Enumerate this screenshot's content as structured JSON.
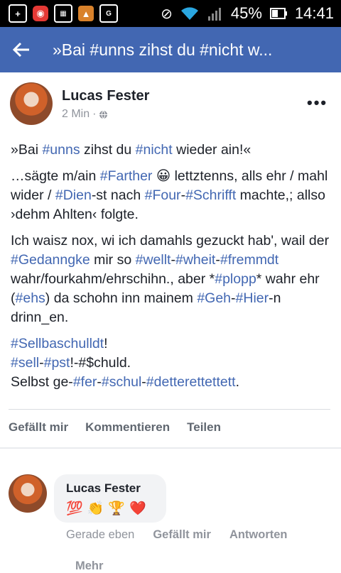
{
  "status_bar": {
    "battery": "45%",
    "time": "14:41"
  },
  "header": {
    "title": "»Bai #unns zihst du #nicht w..."
  },
  "post": {
    "author": "Lucas Fester",
    "time": "2 Min",
    "separator": "·",
    "paragraphs": [
      [
        {
          "t": "»Bai "
        },
        {
          "t": "#unns",
          "tag": true
        },
        {
          "t": " zihst du "
        },
        {
          "t": "#nicht",
          "tag": true
        },
        {
          "t": " wieder ain!«"
        }
      ],
      [
        {
          "t": "…sägte m/ain "
        },
        {
          "t": "#Farther",
          "tag": true
        },
        {
          "t": " 😀 lettztenns, alls ehr / mahl wider / "
        },
        {
          "t": "#Dien",
          "tag": true
        },
        {
          "t": "-st nach "
        },
        {
          "t": "#Four",
          "tag": true
        },
        {
          "t": "-"
        },
        {
          "t": "#Schrifft",
          "tag": true
        },
        {
          "t": " machte,; allso ›dehm Ahlten‹ folgte."
        }
      ],
      [
        {
          "t": "Ich waisz nox, wi ich damahls gezuckt hab', wail der "
        },
        {
          "t": "#Gedanngke",
          "tag": true
        },
        {
          "t": " mir so "
        },
        {
          "t": "#wellt",
          "tag": true
        },
        {
          "t": "-"
        },
        {
          "t": "#wheit",
          "tag": true
        },
        {
          "t": "-"
        },
        {
          "t": "#fremmdt",
          "tag": true
        },
        {
          "t": " wahr/fourkahm/ehrschihn., aber *"
        },
        {
          "t": "#plopp",
          "tag": true
        },
        {
          "t": "* wahr ehr ("
        },
        {
          "t": "#ehs",
          "tag": true
        },
        {
          "t": ") da schohn inn mainem "
        },
        {
          "t": "#Geh",
          "tag": true
        },
        {
          "t": "-"
        },
        {
          "t": "#Hier",
          "tag": true
        },
        {
          "t": "-n drinn_en."
        }
      ],
      [
        {
          "t": "#Sellbaschulldt",
          "tag": true
        },
        {
          "t": "!"
        },
        {
          "br": true
        },
        {
          "t": "#sell",
          "tag": true
        },
        {
          "t": "-"
        },
        {
          "t": "#pst",
          "tag": true
        },
        {
          "t": "!-#$chuld."
        },
        {
          "br": true
        },
        {
          "t": "Selbst ge-"
        },
        {
          "t": "#fer",
          "tag": true
        },
        {
          "t": "-"
        },
        {
          "t": "#schul",
          "tag": true
        },
        {
          "t": "-"
        },
        {
          "t": "#detterettettett",
          "tag": true
        },
        {
          "t": "."
        }
      ]
    ],
    "actions": {
      "like": "Gefällt mir",
      "comment": "Kommentieren",
      "share": "Teilen"
    }
  },
  "comment": {
    "author": "Lucas Fester",
    "emojis": [
      "💯",
      "👏",
      "🏆",
      "❤️"
    ],
    "time": "Gerade eben",
    "like": "Gefällt mir",
    "reply": "Antworten",
    "more": "Mehr"
  },
  "colors": {
    "brand": "#4267b2",
    "hashtag": "#4267b2",
    "muted": "#90949c"
  }
}
